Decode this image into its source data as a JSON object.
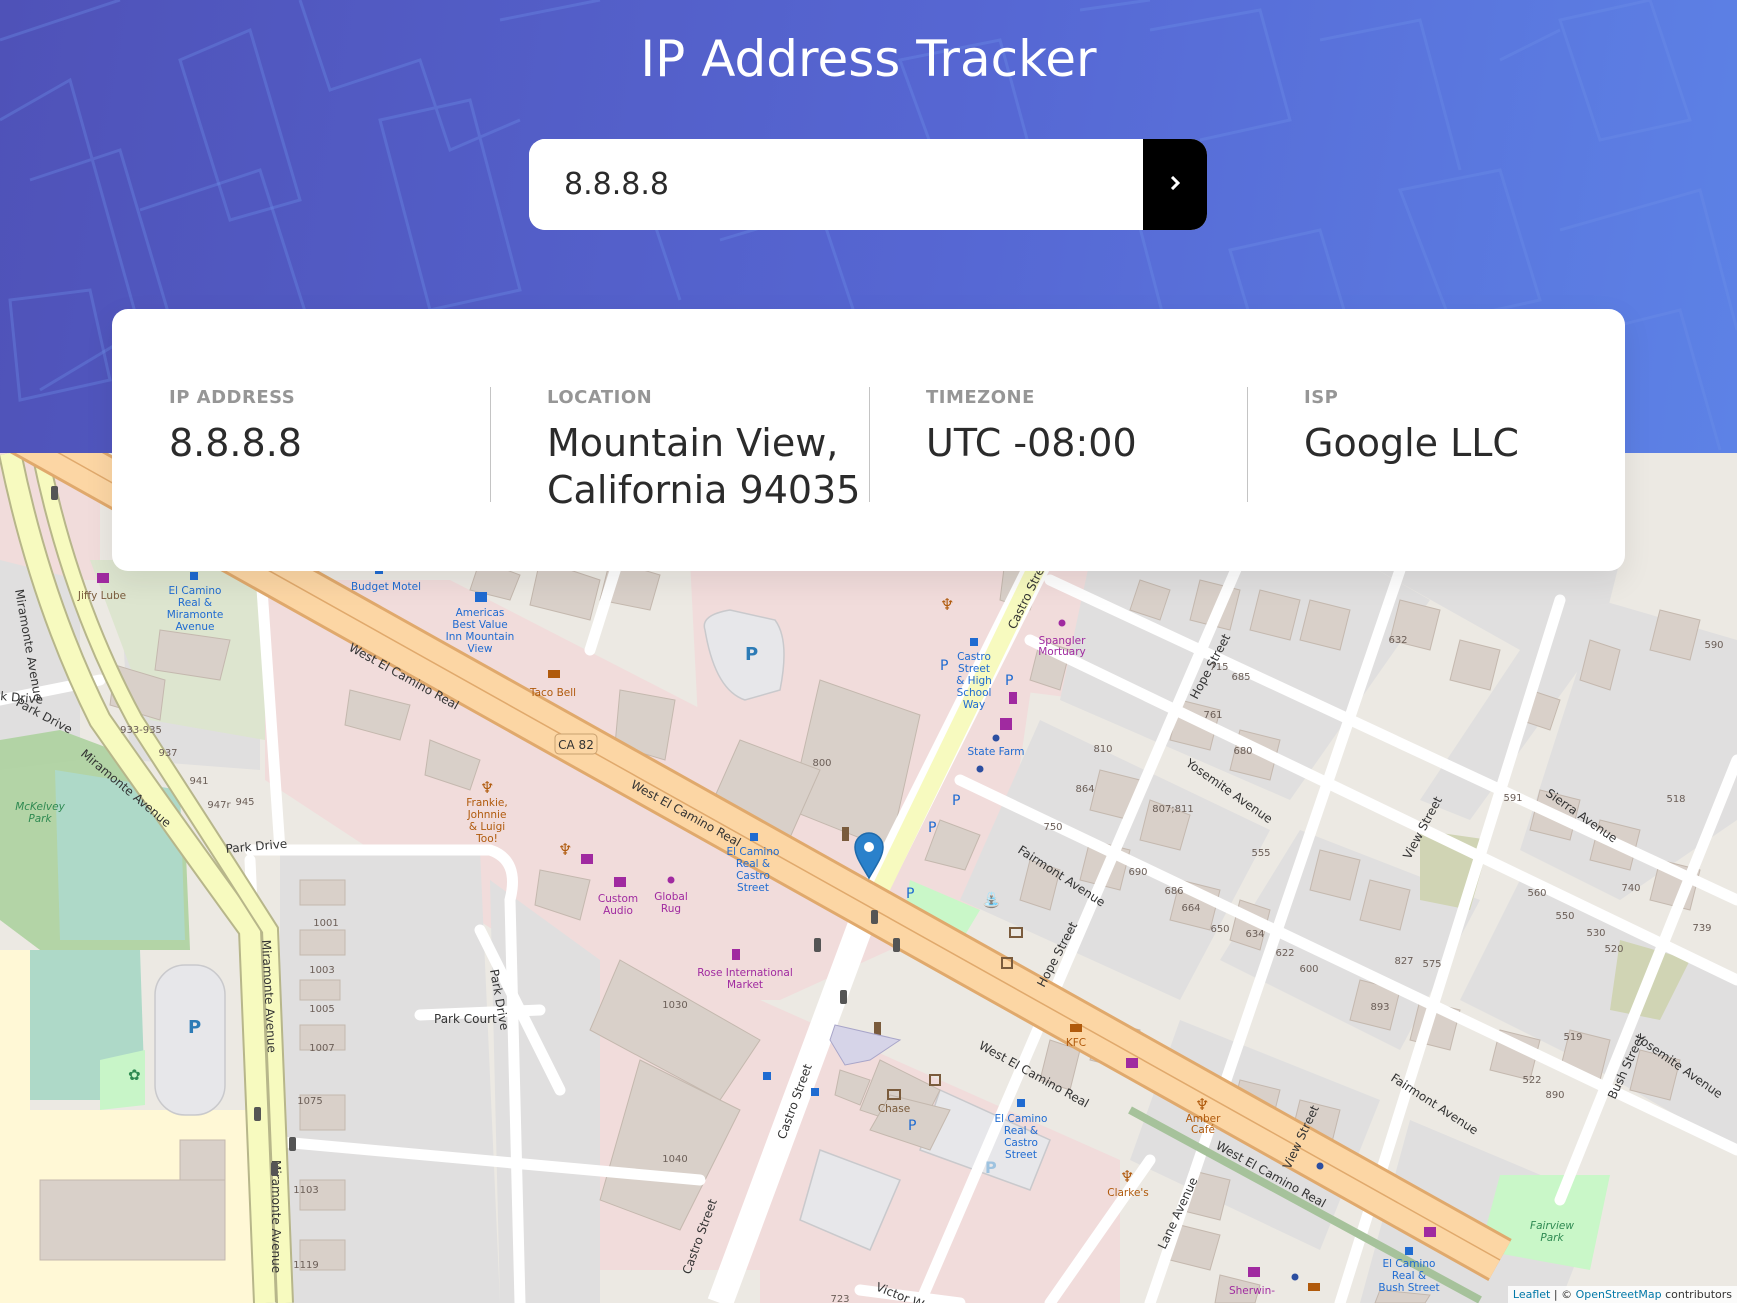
{
  "page": {
    "title": "IP Address Tracker"
  },
  "search": {
    "value": "8.8.8.8",
    "button_icon": "chevron-right-icon"
  },
  "info": [
    {
      "label": "IP ADDRESS",
      "value": "8.8.8.8"
    },
    {
      "label": "LOCATION",
      "value": "Mountain View, California 94035"
    },
    {
      "label": "TIMEZONE",
      "value": "UTC -08:00"
    },
    {
      "label": "ISP",
      "value": "Google LLC"
    }
  ],
  "map": {
    "marker_icon": "map-marker-icon",
    "attribution": {
      "leaflet": "Leaflet",
      "separator": " | © ",
      "osm": "OpenStreetMap",
      "suffix": " contributors"
    },
    "labels": {
      "west_el_camino_real": "West El Camino Real",
      "ca82": "CA 82",
      "castro_street": "Castro Street",
      "hope_street": "Hope Street",
      "yosemite_avenue": "Yosemite Avenue",
      "fairmont_avenue": "Fairmont Avenue",
      "view_street": "View Street",
      "sierra_avenue": "Sierra Avenue",
      "bush_street": "Bush Street",
      "lane_avenue": "Lane Avenue",
      "victor_way": "Victor Wa",
      "miramonte_avenue": "Miramonte Avenue",
      "park_drive": "Park Drive",
      "park_court": "Park Court",
      "k_drive": "k Drive",
      "jiffy_lube": "Jiffy Lube",
      "budget_motel": "Budget Motel",
      "americas_best_value_1": "Americas",
      "americas_best_value_2": "Best Value",
      "americas_best_value_3": "Inn Mountain",
      "americas_best_value_4": "View",
      "taco_bell": "Taco Bell",
      "spangler_mortuary_1": "Spangler",
      "spangler_mortuary_2": "Mortuary",
      "state_farm": "State Farm",
      "castro_high_school_1": "Castro",
      "castro_high_school_2": "Street",
      "castro_high_school_3": "& High",
      "castro_high_school_4": "School",
      "castro_high_school_5": "Way",
      "ecr_miramonte_1": "El Camino",
      "ecr_miramonte_2": "Real &",
      "ecr_miramonte_3": "Miramonte",
      "ecr_miramonte_4": "Avenue",
      "frankie_1": "Frankie,",
      "frankie_2": "Johnnie",
      "frankie_3": "& Luigi",
      "frankie_4": "Too!",
      "ecr_castro_1": "El Camino",
      "ecr_castro_2": "Real &",
      "ecr_castro_3": "Castro",
      "ecr_castro_4": "Street",
      "custom_audio_1": "Custom",
      "custom_audio_2": "Audio",
      "global_rug_1": "Global",
      "global_rug_2": "Rug",
      "rose_market_1": "Rose International",
      "rose_market_2": "Market",
      "chase": "Chase",
      "ecr_castro_b_1": "El Camino",
      "ecr_castro_b_2": "Real &",
      "ecr_castro_b_3": "Castro",
      "ecr_castro_b_4": "Street",
      "kfc": "KFC",
      "amber_cafe_1": "Amber",
      "amber_cafe_2": "Café",
      "clarkes": "Clarke's",
      "ecr_bush_1": "El Camino",
      "ecr_bush_2": "Real &",
      "ecr_bush_3": "Bush Street",
      "sherwin_williams": "Sherwin-",
      "mckelvey_park_1": "McKelvey",
      "mckelvey_park_2": "Park",
      "fairview_park_1": "Fairview",
      "fairview_park_2": "Park",
      "n_933": "933-935",
      "n_937": "937",
      "n_941": "941",
      "n_947r": "947r",
      "n_945": "945",
      "n_800": "800",
      "n_1001": "1001",
      "n_1003": "1003",
      "n_1005": "1005",
      "n_1007": "1007",
      "n_1075": "1075",
      "n_1103": "1103",
      "n_1119": "1119",
      "n_1030": "1030",
      "n_1040": "1040",
      "n_723": "723",
      "n_715": "715",
      "n_685": "685",
      "n_761": "761",
      "n_680": "680",
      "n_810": "810",
      "n_864": "864",
      "n_750": "750",
      "n_807": "807;811",
      "n_690": "690",
      "n_686": "686",
      "n_664": "664",
      "n_650": "650",
      "n_634": "634",
      "n_622": "622",
      "n_600": "600",
      "n_555": "555",
      "n_632": "632",
      "n_591": "591",
      "n_590": "590",
      "n_518": "518",
      "n_560": "560",
      "n_550": "550",
      "n_530": "530",
      "n_520": "520",
      "n_740": "740",
      "n_739": "739",
      "n_827": "827",
      "n_575": "575",
      "n_893": "893",
      "n_519": "519",
      "n_522": "522",
      "n_890": "890"
    }
  }
}
